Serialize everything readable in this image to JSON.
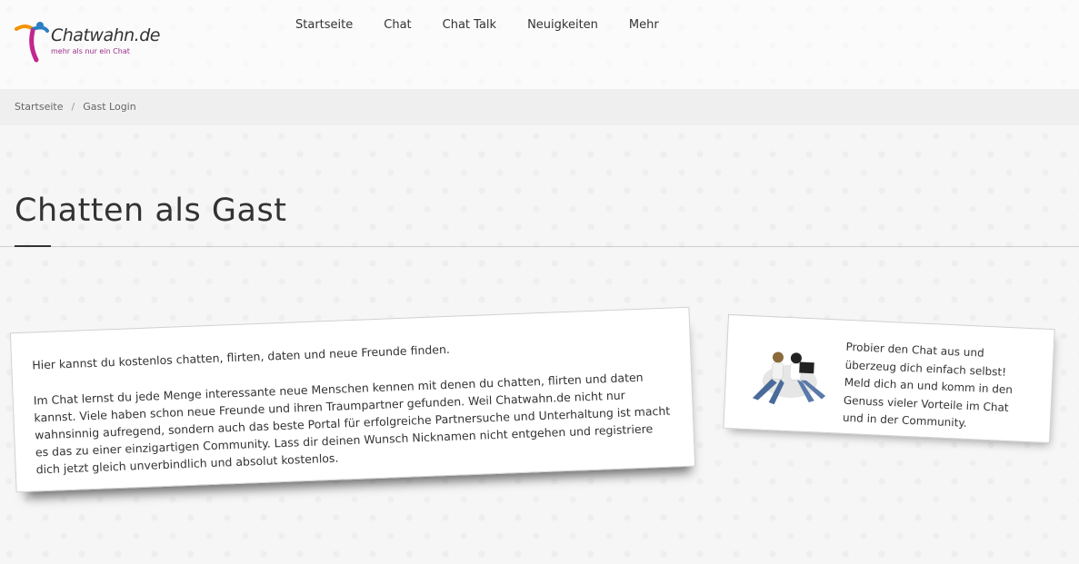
{
  "header": {
    "logo_text": "Chatwahn.de",
    "logo_tagline": "mehr als nur ein Chat",
    "nav": [
      {
        "label": "Startseite"
      },
      {
        "label": "Chat"
      },
      {
        "label": "Chat Talk"
      },
      {
        "label": "Neuigkeiten"
      },
      {
        "label": "Mehr"
      }
    ]
  },
  "breadcrumb": {
    "home": "Startseite",
    "separator": "/",
    "current": "Gast Login"
  },
  "page": {
    "title": "Chatten als Gast"
  },
  "main_card": {
    "paragraph_1": "Hier kannst du kostenlos chatten, flirten, daten und neue Freunde finden.",
    "paragraph_2": "Im Chat lernst du jede Menge interessante neue Menschen kennen mit denen du chatten, flirten und daten kannst. Viele haben schon neue Freunde und ihren Traumpartner gefunden. Weil Chatwahn.de nicht nur wahnsinnig aufregend, sondern auch das beste Portal für erfolgreiche Partnersuche und Unterhaltung ist macht es das zu einer einzigartigen Community. Lass dir deinen Wunsch Nicknamen nicht entgehen und registriere dich jetzt gleich unverbindlich und absolut kostenlos."
  },
  "side_card": {
    "text": "Probier den Chat aus und überzeug dich einfach selbst! Meld dich an und komm in den Genuss vieler Vorteile im Chat und in der Community."
  },
  "colors": {
    "logo_magenta": "#c2268f",
    "logo_orange": "#f39200",
    "logo_blue": "#2b7fc3",
    "breadcrumb_bg": "#efefef"
  }
}
